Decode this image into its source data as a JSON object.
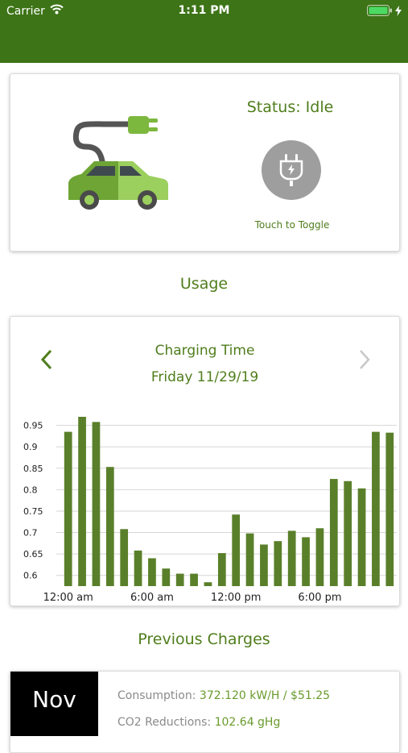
{
  "status_bar": {
    "carrier": "Carrier",
    "time": "1:11 PM"
  },
  "colors": {
    "brand_green": "#3d7417",
    "text_green": "#4f7d1c",
    "bar_green": "#5a7f2a",
    "toggle_gray": "#9e9e9e"
  },
  "status_card": {
    "status_label": "Status: Idle",
    "toggle_hint": "Touch to Toggle",
    "car_icon": "ev-car-plug-icon",
    "toggle_icon": "plug-icon"
  },
  "usage": {
    "title": "Usage"
  },
  "chart_card": {
    "prev_icon": "chevron-left-icon",
    "next_icon": "chevron-right-icon",
    "title": "Charging Time",
    "date": "Friday 11/29/19"
  },
  "chart_data": {
    "type": "bar",
    "title": "Charging Time",
    "subtitle": "Friday 11/29/19",
    "x": [
      "0",
      "1",
      "2",
      "3",
      "4",
      "5",
      "6",
      "7",
      "8",
      "9",
      "10",
      "11",
      "12",
      "13",
      "14",
      "15",
      "16",
      "17",
      "18",
      "19",
      "20",
      "21",
      "22",
      "23"
    ],
    "x_tick_labels": [
      "12:00 am",
      "6:00 am",
      "12:00 pm",
      "6:00 pm"
    ],
    "values": [
      0.935,
      0.97,
      0.958,
      0.853,
      0.708,
      0.658,
      0.64,
      0.616,
      0.604,
      0.604,
      0.584,
      0.652,
      0.742,
      0.698,
      0.672,
      0.68,
      0.704,
      0.689,
      0.71,
      0.825,
      0.82,
      0.803,
      0.935,
      0.933
    ],
    "y_ticks": [
      0.6,
      0.65,
      0.7,
      0.75,
      0.8,
      0.85,
      0.9,
      0.95
    ],
    "y_tick_labels": [
      "0.6",
      "0.65",
      "0.7",
      "0.75",
      "0.8",
      "0.85",
      "0.9",
      "0.95"
    ],
    "ylim": [
      0.575,
      0.97
    ],
    "grid": true
  },
  "previous_charges": {
    "title": "Previous Charges",
    "items": [
      {
        "month": "Nov",
        "consumption_label": "Consumption:",
        "consumption_value": "372.120 kW/H / $51.25",
        "co2_label": "CO2 Reductions:",
        "co2_value": "102.64 gHg"
      }
    ]
  }
}
